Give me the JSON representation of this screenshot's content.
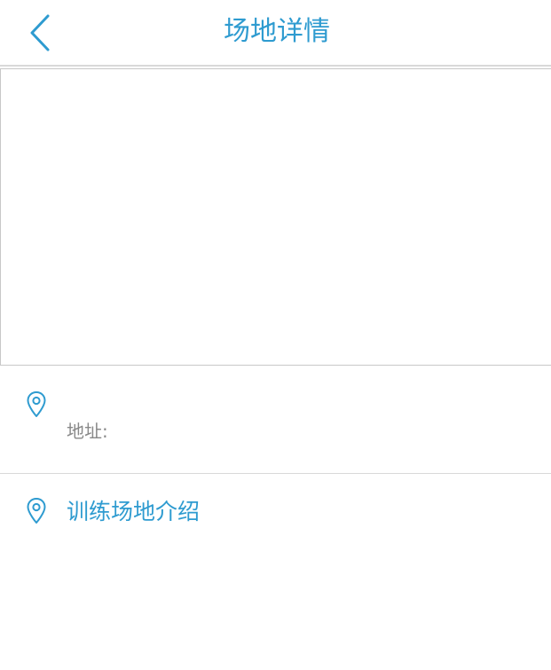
{
  "header": {
    "title": "场地详情",
    "back_icon": "chevron-left-icon"
  },
  "address": {
    "icon": "location-pin-icon",
    "label": "地址:"
  },
  "intro": {
    "icon": "location-pin-icon",
    "title": "训练场地介绍"
  },
  "colors": {
    "accent": "#2e9bd0",
    "muted_text": "#888888",
    "divider": "#d9d9d9"
  }
}
